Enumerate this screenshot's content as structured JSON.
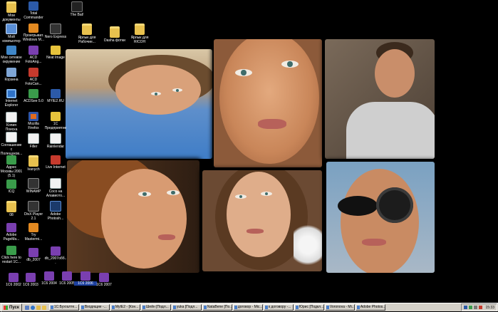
{
  "desktop": {
    "icons": [
      {
        "label": "Мои документы",
        "icon": "folder-icon"
      },
      {
        "label": "Total Commander",
        "icon": "total-commander-icon"
      },
      {
        "label": "The Bat!",
        "icon": "the-bat-icon"
      },
      {
        "label": "Мой компьютер",
        "icon": "computer-icon"
      },
      {
        "label": "Проигрыват. Windows M...",
        "icon": "media-player-icon"
      },
      {
        "label": "Nero Express",
        "icon": "nero-icon"
      },
      {
        "label": "Ярлык для Рабочие...",
        "icon": "folder-icon"
      },
      {
        "label": "Dasha фотки",
        "icon": "folder-icon"
      },
      {
        "label": "Ярлык для RICOH",
        "icon": "folder-icon"
      },
      {
        "label": "Мое сетевое окружение",
        "icon": "network-icon"
      },
      {
        "label": "ACD FotoAng...",
        "icon": "acd-icon"
      },
      {
        "label": "Neat Image",
        "icon": "neat-image-icon"
      },
      {
        "label": "Корзина",
        "icon": "recycle-bin-icon"
      },
      {
        "label": "ACD FotoCan...",
        "icon": "acd-icon"
      },
      {
        "label": "Internet Explorer",
        "icon": "internet-explorer-icon"
      },
      {
        "label": "ACDSee 5.0",
        "icon": "acdsee-icon"
      },
      {
        "label": "MYIE2.RU",
        "icon": "myie-icon"
      },
      {
        "label": "Копия Поиска",
        "icon": "document-icon"
      },
      {
        "label": "Mozilla Firefox",
        "icon": "firefox-icon"
      },
      {
        "label": "1С Предприятие",
        "icon": "1c-icon"
      },
      {
        "label": "Соглашение с Полещуков...",
        "icon": "document-icon"
      },
      {
        "label": "Filler",
        "icon": "filler-icon"
      },
      {
        "label": "Rainlendar",
        "icon": "rainlendar-icon"
      },
      {
        "label": "Адрес Москвы 2001 (5.1)",
        "icon": "address-icon"
      },
      {
        "label": "Ivanych",
        "icon": "folder-icon"
      },
      {
        "label": "Live Internet",
        "icon": "live-internet-icon"
      },
      {
        "label": "ICQ",
        "icon": "icq-icon"
      },
      {
        "label": "WINAMP",
        "icon": "winamp-icon"
      },
      {
        "label": "Coco на Алавиото...",
        "icon": "document-icon"
      },
      {
        "label": "08",
        "icon": "folder-icon"
      },
      {
        "label": "DivX Player 2.1",
        "icon": "divx-icon"
      },
      {
        "label": "Adobe Photosh...",
        "icon": "photoshop-icon"
      },
      {
        "label": "Adobe PageMa...",
        "icon": "pagemaker-icon"
      },
      {
        "label": "Try Mastermi...",
        "icon": "mastermind-icon"
      },
      {
        "label": "Click here to restart 1C...",
        "icon": "1c-restart-icon"
      },
      {
        "label": "db_2007",
        "icon": "rar-icon"
      },
      {
        "label": "db_2007обб...",
        "icon": "rar-icon"
      },
      {
        "label": "1C6 2002",
        "icon": "rar-icon"
      },
      {
        "label": "1C6 2003",
        "icon": "rar-icon"
      },
      {
        "label": "1C6 2004",
        "icon": "rar-icon"
      },
      {
        "label": "1C6 2005",
        "icon": "rar-icon"
      },
      {
        "label": "1C6 2006",
        "icon": "rar-icon"
      },
      {
        "label": "1C6 2007",
        "icon": "rar-icon"
      }
    ]
  },
  "taskbar": {
    "start_label": "Пуск",
    "tasks": [
      "1С:Бухгалте...",
      "Входящие -...",
      "MyIE2 - [Кон...",
      "Шейн [Подл...",
      "yuka [Подл...",
      "NataBene [По...",
      "договор - Mic...",
      "к договору -...",
      "Юрис [Подкл...",
      "Voronova - Mi...",
      "Adobe Photos..."
    ],
    "clock": "15:33"
  }
}
